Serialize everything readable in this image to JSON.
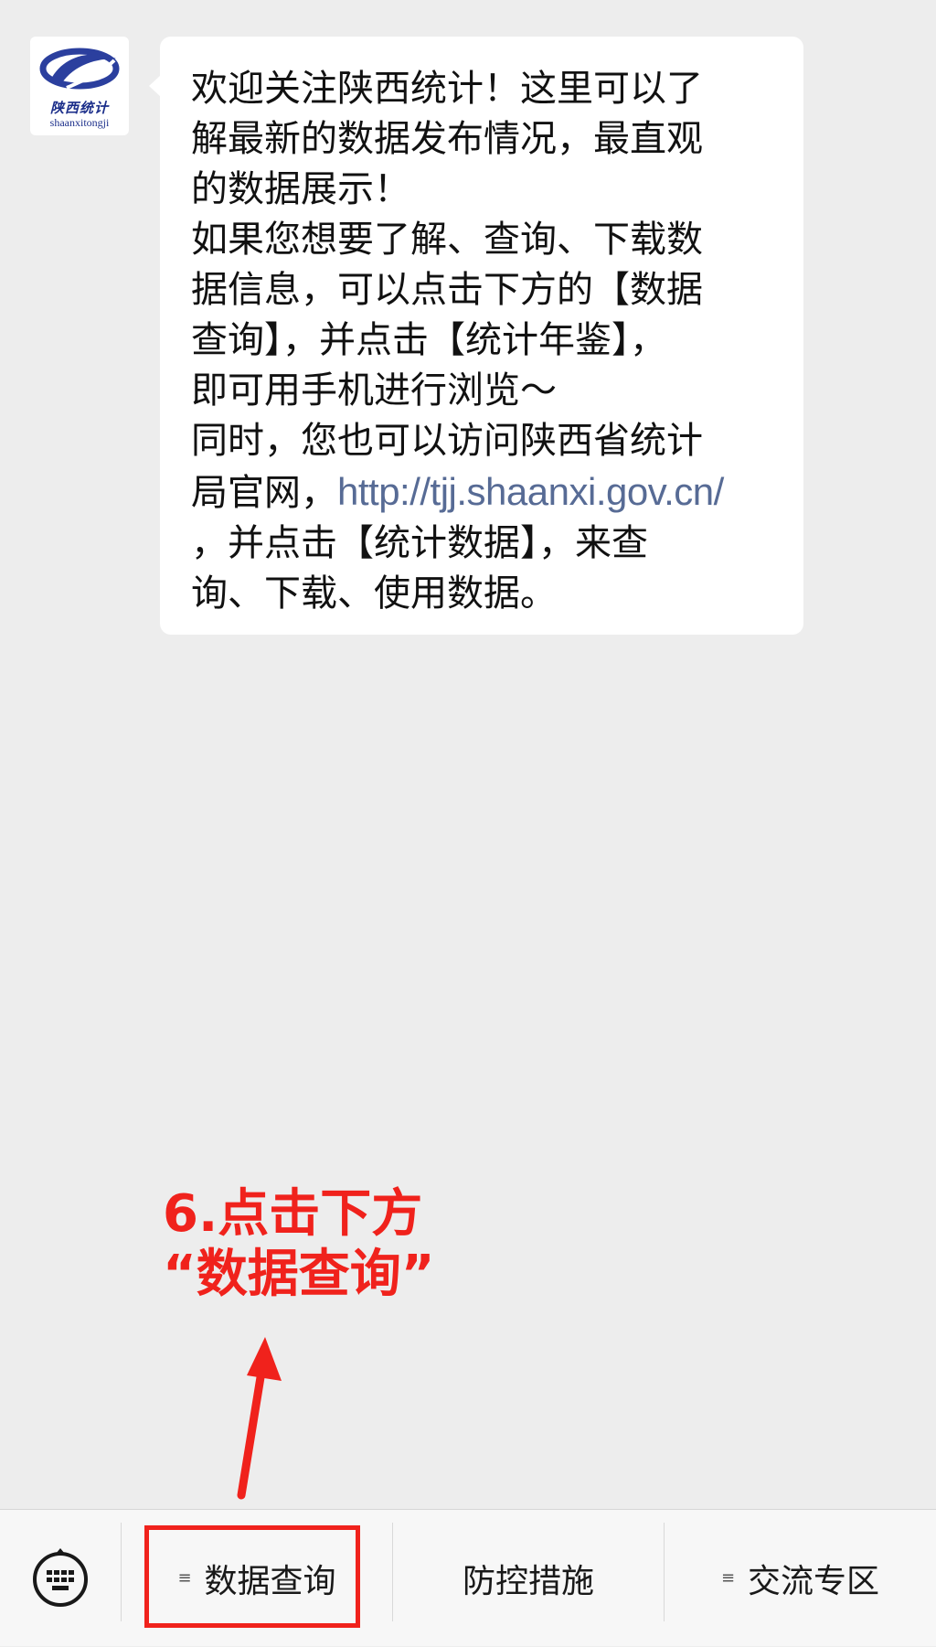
{
  "chat": {
    "avatar": {
      "logo_cn": "陕西统计",
      "logo_en": "shaanxitongji",
      "logo_color": "#1b2e8a"
    },
    "message": {
      "lines": [
        "欢迎关注陕西统计！这里可以了",
        "解最新的数据发布情况，最直观",
        "的数据展示！",
        "如果您想要了解、查询、下载数",
        "据信息，可以点击下方的【数据",
        "查询】，并点击【统计年鉴】，",
        "即可用手机进行浏览～",
        "同时，您也可以访问陕西省统计",
        "局官网，",
        "，并点击【统计数据】，来查",
        "询、下载、使用数据。"
      ],
      "link": "http://tjj.shaanxi.gov.cn/",
      "link_color": "#576b95"
    }
  },
  "annotation": {
    "line1": "6.点击下方",
    "line2": "“数据查询”",
    "color": "#f0221c"
  },
  "menu": {
    "keyboard_icon": "keyboard-icon",
    "items": [
      {
        "label": "数据查询",
        "has_submenu": true,
        "icon": "submenu-list-icon"
      },
      {
        "label": "防控措施",
        "has_submenu": false
      },
      {
        "label": "交流专区",
        "has_submenu": true,
        "icon": "submenu-list-icon"
      }
    ]
  }
}
